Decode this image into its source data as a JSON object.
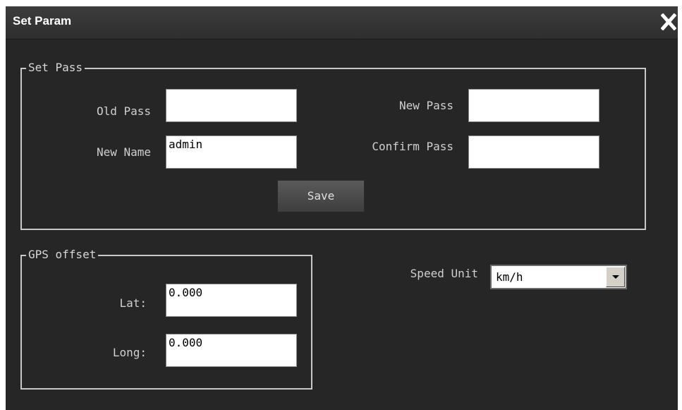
{
  "window": {
    "title": "Set Param",
    "close_icon": "close-icon"
  },
  "set_pass": {
    "legend": "Set Pass",
    "old_pass_label": "Old Pass",
    "old_pass_value": "",
    "new_pass_label": "New Pass",
    "new_pass_value": "",
    "new_name_label": "New Name",
    "new_name_value": "admin",
    "confirm_pass_label": "Confirm Pass",
    "confirm_pass_value": "",
    "save_label": "Save"
  },
  "gps_offset": {
    "legend": "GPS offset",
    "lat_label": "Lat:",
    "lat_value": "0.000",
    "long_label": "Long:",
    "long_value": "0.000"
  },
  "speed_unit": {
    "label": "Speed Unit",
    "selected": "km/h",
    "dropdown_icon": "chevron-down-icon"
  },
  "colors": {
    "background": "#262626",
    "titlebar": "#363636",
    "border": "#c8c8c8",
    "text": "#d0d0d0"
  }
}
